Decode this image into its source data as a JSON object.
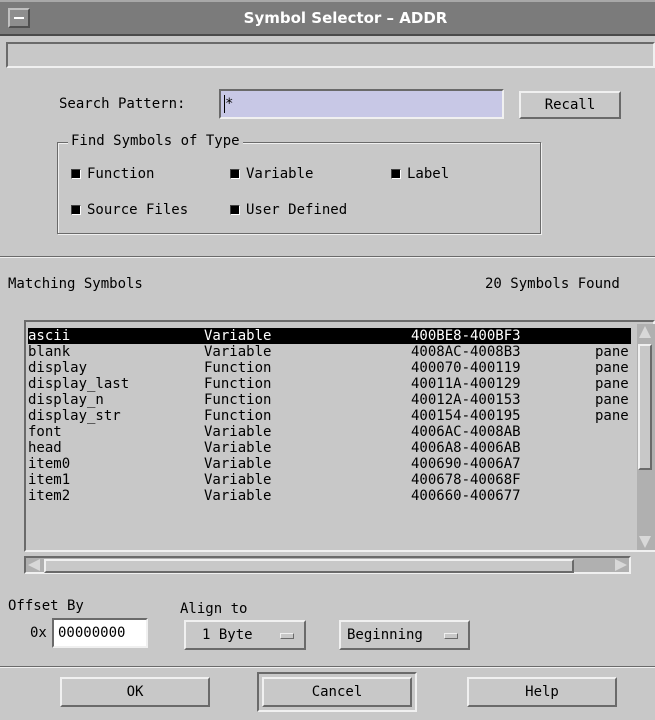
{
  "window": {
    "title": "Symbol Selector – ADDR"
  },
  "search": {
    "label": "Search Pattern:",
    "value": "*",
    "recall_label": "Recall"
  },
  "find_types": {
    "title": "Find Symbols of Type",
    "options": [
      {
        "label": "Function",
        "checked": true
      },
      {
        "label": "Variable",
        "checked": true
      },
      {
        "label": "Label",
        "checked": true
      },
      {
        "label": "Source Files",
        "checked": true
      },
      {
        "label": "User Defined",
        "checked": true
      }
    ]
  },
  "matching": {
    "label": "Matching Symbols",
    "count_text": "20 Symbols Found",
    "rows": [
      {
        "name": "ascii",
        "type": "Variable",
        "range": "400BE8-400BF3",
        "extra": "",
        "selected": true
      },
      {
        "name": "blank",
        "type": "Variable",
        "range": "4008AC-4008B3",
        "extra": "pane",
        "selected": false
      },
      {
        "name": "display",
        "type": "Function",
        "range": "400070-400119",
        "extra": "pane",
        "selected": false
      },
      {
        "name": "display_last",
        "type": "Function",
        "range": "40011A-400129",
        "extra": "pane",
        "selected": false
      },
      {
        "name": "display_n",
        "type": "Function",
        "range": "40012A-400153",
        "extra": "pane",
        "selected": false
      },
      {
        "name": "display_str",
        "type": "Function",
        "range": "400154-400195",
        "extra": "pane",
        "selected": false
      },
      {
        "name": "font",
        "type": "Variable",
        "range": "4006AC-4008AB",
        "extra": "",
        "selected": false
      },
      {
        "name": "head",
        "type": "Variable",
        "range": "4006A8-4006AB",
        "extra": "",
        "selected": false
      },
      {
        "name": "item0",
        "type": "Variable",
        "range": "400690-4006A7",
        "extra": "",
        "selected": false
      },
      {
        "name": "item1",
        "type": "Variable",
        "range": "400678-40068F",
        "extra": "",
        "selected": false
      },
      {
        "name": "item2",
        "type": "Variable",
        "range": "400660-400677",
        "extra": "",
        "selected": false
      }
    ]
  },
  "offset": {
    "label": "Offset By",
    "prefix": "0x",
    "value": "00000000"
  },
  "align": {
    "label": "Align to",
    "size_value": "1 Byte",
    "position_value": "Beginning"
  },
  "buttons": {
    "ok": "OK",
    "cancel": "Cancel",
    "help": "Help"
  }
}
